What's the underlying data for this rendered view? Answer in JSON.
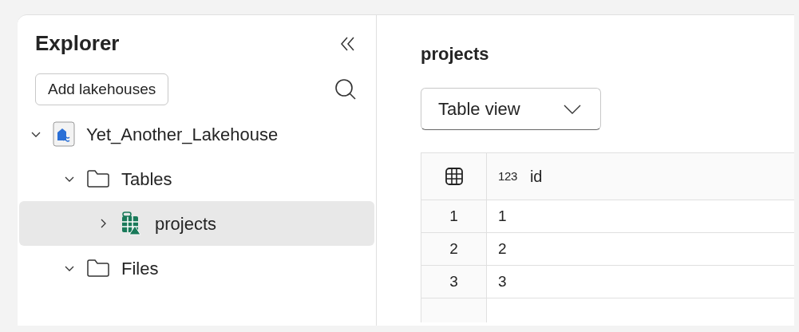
{
  "explorer": {
    "title": "Explorer",
    "add_button": "Add lakehouses",
    "tree": [
      {
        "label": "Yet_Another_Lakehouse",
        "kind": "lakehouse",
        "expanded": true,
        "selected": false,
        "children": [
          {
            "label": "Tables",
            "kind": "folder",
            "expanded": true,
            "selected": false,
            "children": [
              {
                "label": "projects",
                "kind": "table",
                "expanded": false,
                "selected": true
              }
            ]
          },
          {
            "label": "Files",
            "kind": "folder",
            "expanded": true,
            "selected": false
          }
        ]
      }
    ]
  },
  "main": {
    "title": "projects",
    "view_dropdown": "Table view",
    "table": {
      "columns": [
        {
          "type_label": "123",
          "name": "id"
        }
      ],
      "rows": [
        {
          "row_number": "1",
          "id": "1"
        },
        {
          "row_number": "2",
          "id": "2"
        },
        {
          "row_number": "3",
          "id": "3"
        }
      ]
    }
  }
}
